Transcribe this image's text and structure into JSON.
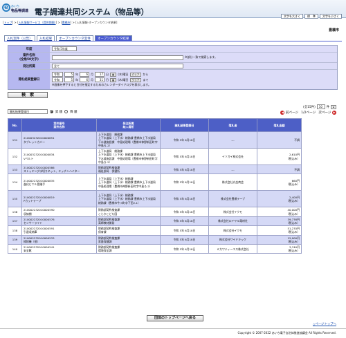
{
  "header": {
    "logo_big": "e",
    "logo_small": "あいち",
    "logo_sub": "物品等調達",
    "title": "電子調達共同システム（物品等）",
    "buttons": [
      "文字を大きく",
      "標　準",
      "文字を小さく"
    ]
  },
  "breadcrumb": {
    "home": "トップ",
    "sep": " > ",
    "p1": "入札情報サービス（提供期間）",
    "p2": "豊橋市",
    "p3": "入札情報-オープンカウンタ結果"
  },
  "org": "豊橋市",
  "tabs": [
    "入札案件（公告）",
    "入札結果",
    "オープンカウンタ案件",
    "オープンカウンタ結果"
  ],
  "form": {
    "rows": [
      {
        "label": "年度",
        "value": "令和 5年度"
      },
      {
        "label1": "案件名称",
        "label2": "(全角50文字)",
        "note": "※部分一致で検索します。"
      },
      {
        "label": "発注所属",
        "value": "全て"
      },
      {
        "label": "開札結果登録日"
      }
    ],
    "date_from": {
      "era": "令和",
      "y": "5",
      "mo": "6",
      "d": "17",
      "wd": "(木)曜日",
      "clear": "クリア",
      "suffix": "から"
    },
    "date_to": {
      "era": "令和",
      "y": "5",
      "mo": "6",
      "d": "31",
      "wd": "(木)曜日",
      "clear": "クリア",
      "suffix": "まで"
    },
    "date_note": "※画像を押下すると日付を指定するためのカレンダーダイアログを表示します。",
    "labels": {
      "year": "年",
      "month": "月",
      "day": "日"
    }
  },
  "search_label": "検　索",
  "controls": {
    "sort": "開札結果登録日",
    "asc": "昇 順",
    "desc": "降 順"
  },
  "count": {
    "text": "(全15件)",
    "per": "10",
    "unit": "件",
    "page": "1/2ページ"
  },
  "pager": {
    "prev": "前ページ",
    "next": "次ページ"
  },
  "table": {
    "headers": [
      "No.",
      "案件番号",
      "案件名称",
      "発注所属",
      "納入場所",
      "開札結果登録日",
      "落札者",
      "落札金額"
    ],
    "rows": [
      {
        "no": "131",
        "id": "210003232010000851",
        "name": "タブレットカバー",
        "dept": "上下水道局　総務課",
        "place": "上下水道局（上下水）総務課 豊橋市上下水道局　下水道施設課　中島処理場（豊橋市神野新田町字中島ろ-2）",
        "date": "令和 5年 6月18日",
        "winner": "---",
        "price": "不調",
        "price2": ""
      },
      {
        "no": "132",
        "id": "210003232010000834",
        "name": "Vベルト",
        "dept": "上下水道局　総務課",
        "place": "上下水道局（上下水）総務課 豊橋市上下水道局　下水道施設課　中島処理場（豊橋市神野新田町字中島ろ-2）",
        "date": "令和 5年 6月18日",
        "winner": "イソガイ株式会社",
        "price": "2,610円",
        "price2": "（税込み）"
      },
      {
        "no": "133",
        "id": "210002232010000586",
        "name": "ストッキング水切りネット、キッチンハイター",
        "dept": "財務部契約検査課",
        "place": "福祉部局　保健所",
        "date": "令和 5年 6月18日",
        "winner": "---",
        "price": "不調",
        "price2": ""
      },
      {
        "no": "134",
        "id": "210002232010000835",
        "name": "進化ビニル管継手",
        "dept": "上下水道局（上下水）総務課",
        "place": "上下水道局（上下水）総務課 豊橋市上下水道局　中島処理場（豊橋市神野新田町字中島ろ-2）",
        "date": "令和 5年 6月18日",
        "winner": "株式会社丸金商会",
        "price": "660円",
        "price2": "（税込み）"
      },
      {
        "no": "135",
        "id": "210002232010000819",
        "name": "Pカットテープ",
        "dept": "上下水道局（上下水）総務課",
        "place": "上下水道局（上下水）総務課 豊橋市上下水道局　総務課（豊橋市牛川町字下田2-1）",
        "date": "令和 5年 6月18日",
        "winner": "株式会社豊橋テープ",
        "price": "2,400円",
        "price2": "（税込み）"
      },
      {
        "no": "136",
        "id": "210002232010000590",
        "name": "収納棚",
        "dept": "財務部契約検査課",
        "place": "こじかこども園",
        "date": "令和 5年 6月18日",
        "winner": "株式会社イクモ",
        "price": "40,000円",
        "price2": "（税込み）"
      },
      {
        "no": "137",
        "id": "210002232010000576",
        "name": "センサーライト",
        "dept": "財務部契約検査課",
        "place": "高師教材開発",
        "date": "令和 5年 6月18日",
        "winner": "株式会社ロイヤル電材社",
        "price": "39,776円",
        "price2": "（税込み）"
      },
      {
        "no": "138",
        "id": "210002232010000591",
        "name": "引違収納庫",
        "dept": "財務部契約検査課",
        "place": "保育課",
        "date": "令和 5年 6月18日",
        "winner": "株式会社イクモ",
        "price": "51,270円",
        "price2": "（税込み）"
      },
      {
        "no": "139",
        "id": "210002232010000533",
        "name": "掃除機（他）",
        "dept": "財務部契約検査課",
        "place": "家畜保健課",
        "date": "令和 5年 6月18日",
        "winner": "株式会社サイドキック",
        "price": "15,000円",
        "price2": "（税込み）"
      },
      {
        "no": "140",
        "id": "210002232010000541",
        "name": "安全靴",
        "dept": "財務部契約検査課",
        "place": "環境保全課",
        "date": "令和 5年 6月18日",
        "winner": "ミカワティーエス株式会社",
        "price": "3,740円",
        "price2": "（税込み）"
      }
    ]
  },
  "back_button": "団体のトップページへ戻る",
  "to_top": "△ページトップへ",
  "footer": "Copyright © 2007-2022 あいち電子自治体推進協議会 All Rights Reserved."
}
